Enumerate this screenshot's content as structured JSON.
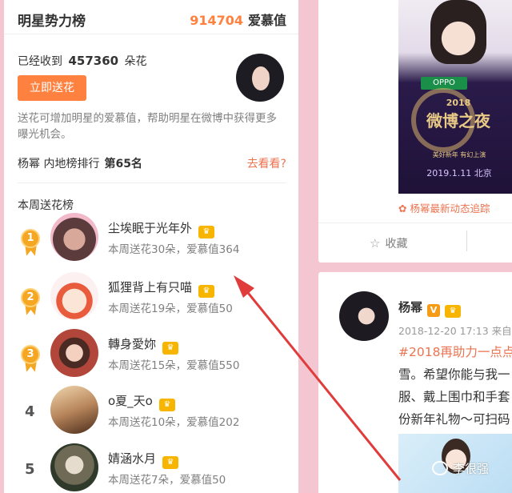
{
  "left_panel": {
    "title": "明星势力榜",
    "love_value": "914704",
    "love_label": "爱慕值",
    "received_prefix": "已经收到",
    "received_count": "457360",
    "received_unit": "朵花",
    "send_button": "立即送花",
    "description": "送花可增加明星的爱慕值，帮助明星在微博中获得更多曝光机会。",
    "rank_prefix": "杨幂 内地榜排行",
    "rank_value": "第65名",
    "go_link": "去看看?",
    "weekly_title": "本周送花榜",
    "items": [
      {
        "rank": "1",
        "name": "尘埃眠于光年外",
        "stats": "本周送花30朵，爱慕值364"
      },
      {
        "rank": "2",
        "name": "狐狸背上有只喵",
        "stats": "本周送花19朵，爱慕值50"
      },
      {
        "rank": "3",
        "name": "轉身愛妳",
        "stats": "本周送花15朵，爱慕值550"
      },
      {
        "rank": "4",
        "name": "o夏_天o",
        "stats": "本周送花10朵，爱慕值202"
      },
      {
        "rank": "5",
        "name": "婧涵水月",
        "stats": "本周送花7朵，爱慕值50"
      }
    ]
  },
  "right_top": {
    "poster_brand": "OPPO",
    "poster_title": "微博之夜",
    "poster_year": "2018",
    "poster_slogan": "美好新年 有幻上演",
    "poster_date": "2019.1.11 北京",
    "link_text": "杨幂最新动态追踪",
    "collect_label": "收藏"
  },
  "right_bottom": {
    "user_name": "杨幂",
    "verified_badge": "V",
    "meta": "2018-12-20 17:13 来自",
    "text_lines": [
      "#2018再助力一点点",
      "雪。希望你能与我一",
      "服、戴上围巾和手套",
      "份新年礼物～可扫码"
    ]
  },
  "watermark": "李很强",
  "colors": {
    "accent": "#ff8140",
    "link": "#eb7350",
    "page_bg": "#f4c6d2",
    "arrow": "#e03c3c"
  }
}
